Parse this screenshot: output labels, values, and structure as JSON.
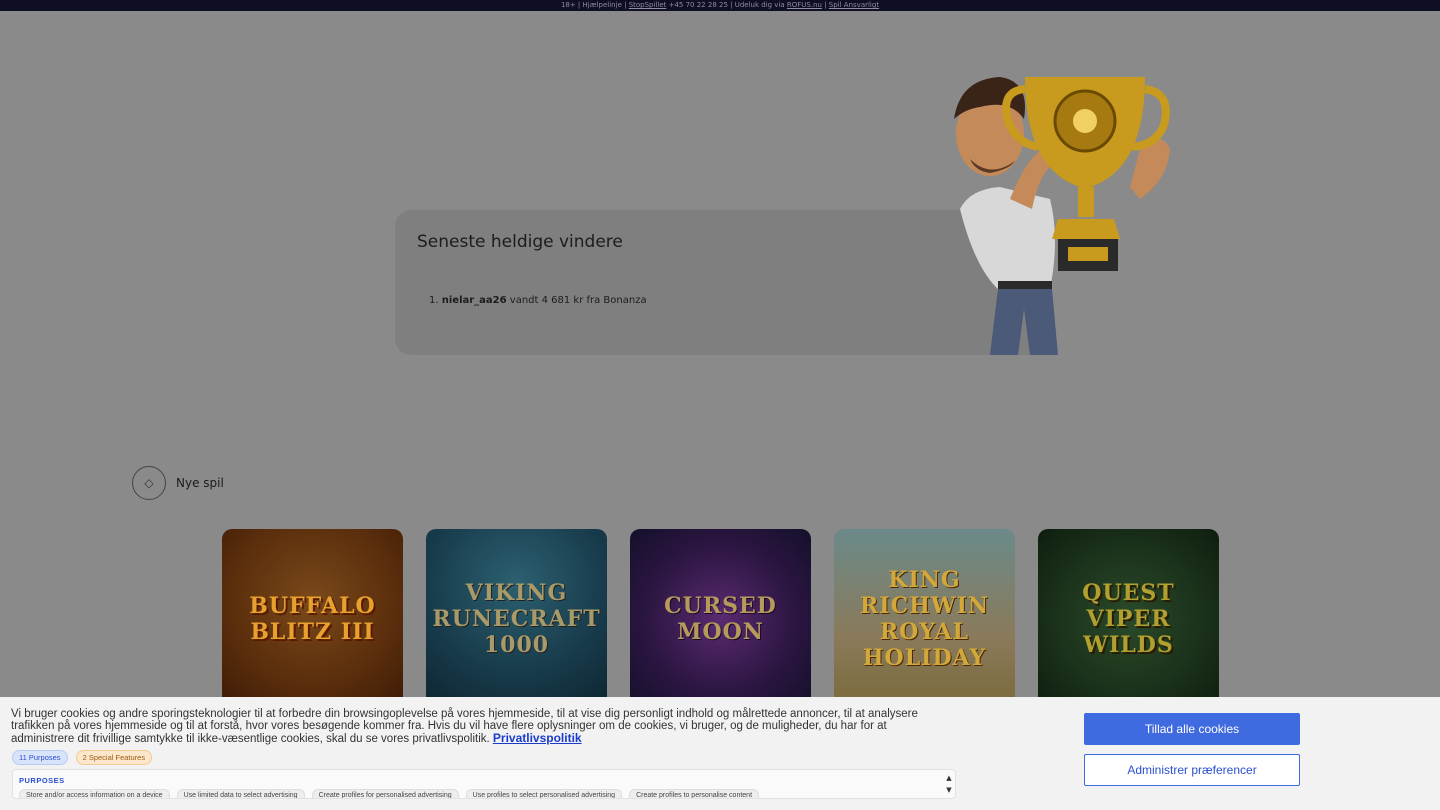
{
  "topbar": {
    "prefix": "18+ | Hjælpelinje | ",
    "stop_link": "StopSpillet",
    "phone": " +45 70 22 28 25 | Udeluk dig via ",
    "rofus_link": "ROFUS.nu",
    "sep": " | ",
    "responsible_link": "Spil Ansvarligt"
  },
  "winners": {
    "title": "Seneste heldige vindere",
    "items": [
      {
        "rank": "1.",
        "user": "nielar_aa26",
        "text": " vandt 4 681 kr fra Bonanza"
      }
    ]
  },
  "new_games": {
    "title": "Nye spil",
    "icon": "diamond-icon",
    "games": [
      {
        "title": "BUFFALO BLITZ III"
      },
      {
        "title": "VIKING RUNECRAFT 1000"
      },
      {
        "title": "CURSED MOON"
      },
      {
        "title": "KING RICHWIN ROYAL HOLIDAY"
      },
      {
        "title": "QUEST VIPER WILDS"
      }
    ]
  },
  "cookie": {
    "text": "Vi bruger cookies og andre sporingsteknologier til at forbedre din browsingoplevelse på vores hjemmeside, til at vise dig personligt indhold og målrettede annoncer, til at analysere trafikken på vores hjemmeside og til at forstå, hvor vores besøgende kommer fra. Hvis du vil have flere oplysninger om de cookies, vi bruger, og de muligheder, du har for at administrere dit frivillige samtykke til ikke-væsentlige cookies, skal du se vores privatlivspolitik.",
    "privacy_link": "Privatlivspolitik",
    "chip_purposes": "11 Purposes",
    "chip_special": "2 Special Features",
    "purposes_label": "PURPOSES",
    "purposes": [
      "Store and/or access information on a device",
      "Use limited data to select advertising",
      "Create profiles for personalised advertising",
      "Use profiles to select personalised advertising",
      "Create profiles to personalise content"
    ],
    "accept_label": "Tillad alle cookies",
    "prefs_label": "Administrer præferencer"
  },
  "colors": {
    "accent": "#3f6ae0",
    "topbar_bg": "#0e0e24",
    "overlay_bg": "#8a8a8a"
  }
}
